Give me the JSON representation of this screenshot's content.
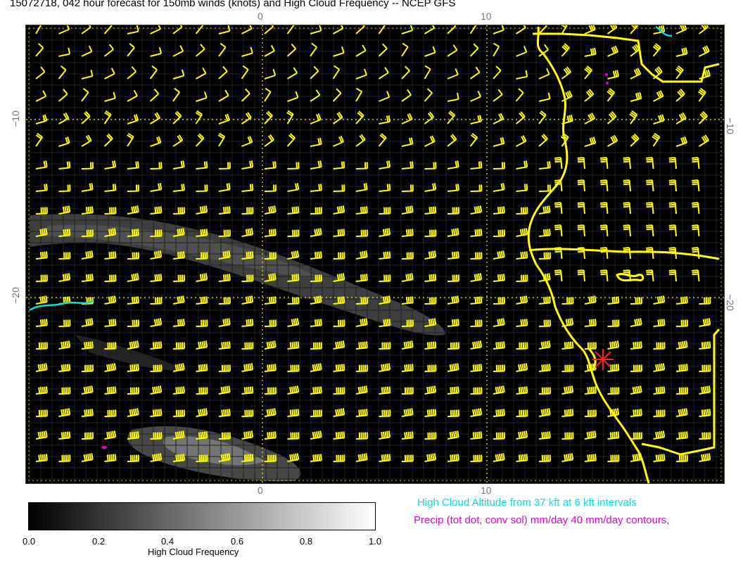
{
  "header": {
    "title": "15072718, 042 hour forecast for 150mb winds (knots) and High Cloud Frequency -- NCEP GFS"
  },
  "map": {
    "lon_labels_top": [
      "0",
      "10"
    ],
    "lon_labels_bottom": [
      "0",
      "10"
    ],
    "lat_labels_left": [
      "−10",
      "−20"
    ],
    "lat_labels_right": [
      "−10",
      "−20"
    ],
    "colors": {
      "background": "#000000",
      "barbs": "#ffff00",
      "coast": "#ffff00",
      "cloud_altitude": "#00e0e0",
      "precip": "#e000e0",
      "marker": "#ff2020"
    }
  },
  "colorbar": {
    "ticks": [
      "0.0",
      "0.2",
      "0.4",
      "0.6",
      "0.8",
      "1.0"
    ],
    "label": "High Cloud Frequency"
  },
  "legend": {
    "cloud_altitude": "High Cloud Altitude from 37 kft at 6 kft intervals",
    "precip": "Precip (tot dot, conv sol) mm/day 40 mm/day contours,"
  }
}
